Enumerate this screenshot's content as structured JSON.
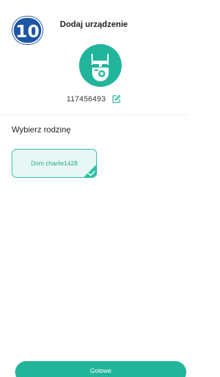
{
  "step_badge": "10",
  "header": {
    "title": "Dodaj urządzenie"
  },
  "device": {
    "icon": "camera-icon",
    "id": "117456493",
    "edit_icon": "edit-icon"
  },
  "family_section": {
    "label": "Wybierz rodzinę",
    "families": [
      {
        "name": "Dom charlie1428",
        "selected": true
      }
    ]
  },
  "footer": {
    "done_label": "Gotowe"
  },
  "colors": {
    "accent": "#22b59b",
    "badge": "#1d56a6",
    "selected_bg": "#e6f7f4"
  }
}
